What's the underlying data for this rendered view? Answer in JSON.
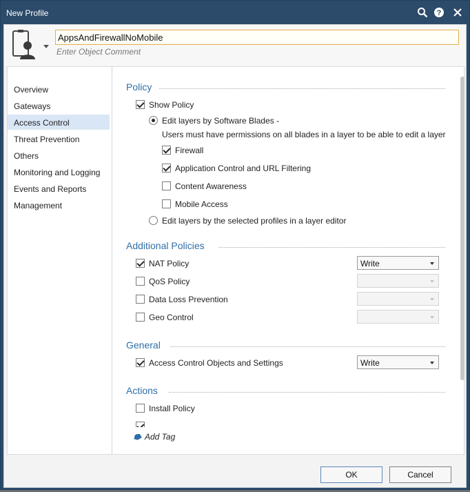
{
  "window": {
    "title": "New Profile"
  },
  "header": {
    "name_value": "AppsAndFirewallNoMobile",
    "comment_placeholder": "Enter Object Comment"
  },
  "sidebar": {
    "items": [
      {
        "label": "Overview"
      },
      {
        "label": "Gateways"
      },
      {
        "label": "Access Control",
        "active": true
      },
      {
        "label": "Threat Prevention"
      },
      {
        "label": "Others"
      },
      {
        "label": "Monitoring and Logging"
      },
      {
        "label": "Events and Reports"
      },
      {
        "label": "Management"
      }
    ]
  },
  "policy": {
    "title": "Policy",
    "show_policy": {
      "label": "Show Policy",
      "checked": true
    },
    "edit_by_blades": {
      "label": "Edit layers by Software Blades -",
      "selected": true
    },
    "note": "Users must have permissions on all blades in a layer to be able to edit a layer",
    "blades": [
      {
        "label": "Firewall",
        "checked": true
      },
      {
        "label": "Application Control and URL Filtering",
        "checked": true
      },
      {
        "label": "Content Awareness",
        "checked": false
      },
      {
        "label": "Mobile Access",
        "checked": false
      }
    ],
    "edit_by_profiles": {
      "label": "Edit layers by the selected profiles in a layer editor",
      "selected": false
    }
  },
  "additional": {
    "title": "Additional Policies",
    "rows": [
      {
        "label": "NAT Policy",
        "checked": true,
        "select": "Write",
        "enabled": true
      },
      {
        "label": "QoS Policy",
        "checked": false,
        "select": "",
        "enabled": false
      },
      {
        "label": "Data Loss Prevention",
        "checked": false,
        "select": "",
        "enabled": false
      },
      {
        "label": "Geo Control",
        "checked": false,
        "select": "",
        "enabled": false
      }
    ]
  },
  "general": {
    "title": "General",
    "row": {
      "label": "Access Control Objects and Settings",
      "checked": true,
      "select": "Write"
    }
  },
  "actions": {
    "title": "Actions",
    "install_policy": {
      "label": "Install Policy",
      "checked": false
    }
  },
  "footer": {
    "add_tag": "Add Tag",
    "ok": "OK",
    "cancel": "Cancel"
  },
  "colors": {
    "titlebar": "#2c4a6a",
    "section_heading": "#2f6ea8",
    "sidebar_active": "#d9e6f5",
    "name_border": "#e2b04a"
  },
  "icons": [
    "search-icon",
    "help-icon",
    "close-icon",
    "profile-avatar-icon",
    "tag-icon"
  ]
}
